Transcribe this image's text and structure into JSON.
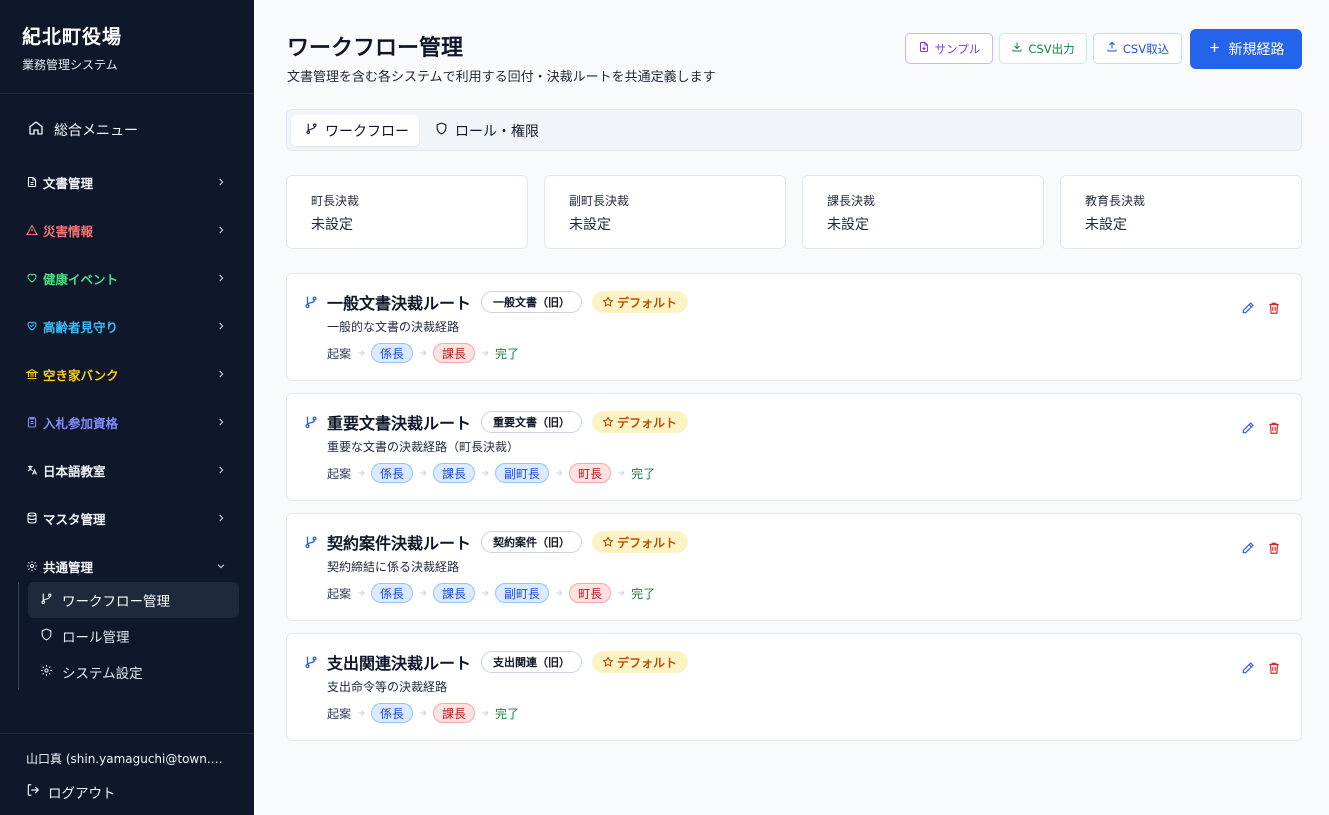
{
  "sidebar": {
    "brand_title": "紀北町役場",
    "brand_subtitle": "業務管理システム",
    "top_item": "総合メニュー",
    "groups": [
      {
        "label": "文書管理",
        "color": "#f1f5f9",
        "icon": "document-icon"
      },
      {
        "label": "災害情報",
        "color": "#f87171",
        "icon": "warning-icon"
      },
      {
        "label": "健康イベント",
        "color": "#4ade80",
        "icon": "heart-icon"
      },
      {
        "label": "高齢者見守り",
        "color": "#38bdf8",
        "icon": "heart-handshake-icon"
      },
      {
        "label": "空き家バンク",
        "color": "#facc15",
        "icon": "landmark-icon"
      },
      {
        "label": "入札参加資格",
        "color": "#818cf8",
        "icon": "clipboard-icon"
      },
      {
        "label": "日本語教室",
        "color": "#f1f5f9",
        "icon": "languages-icon"
      },
      {
        "label": "マスタ管理",
        "color": "#f1f5f9",
        "icon": "database-icon"
      },
      {
        "label": "共通管理",
        "color": "#f1f5f9",
        "icon": "gear-icon"
      }
    ],
    "sub_items": [
      {
        "label": "ワークフロー管理",
        "icon": "workflow-icon"
      },
      {
        "label": "ロール管理",
        "icon": "shield-icon"
      },
      {
        "label": "システム設定",
        "icon": "gear-icon"
      }
    ],
    "user": "山口真 (shin.yamaguchi@town.mi...",
    "logout": "ログアウト"
  },
  "header": {
    "title": "ワークフロー管理",
    "description": "文書管理を含む各システムで利用する回付・決裁ルートを共通定義します",
    "btn_sample": "サンプル",
    "btn_csv_out": "CSV出力",
    "btn_csv_in": "CSV取込",
    "btn_new": "新規経路"
  },
  "tabs": {
    "workflow": "ワークフロー",
    "role": "ロール・権限"
  },
  "summary": [
    {
      "label": "町長決裁",
      "value": "未設定"
    },
    {
      "label": "副町長決裁",
      "value": "未設定"
    },
    {
      "label": "課長決裁",
      "value": "未設定"
    },
    {
      "label": "教育長決裁",
      "value": "未設定"
    }
  ],
  "routes": [
    {
      "name": "一般文書決裁ルート",
      "type": "一般文書（旧）",
      "default": "デフォルト",
      "description": "一般的な文書の決裁経路",
      "start": "起案",
      "end": "完了",
      "steps": [
        {
          "label": "係長",
          "tone": "blue"
        },
        {
          "label": "課長",
          "tone": "red"
        }
      ]
    },
    {
      "name": "重要文書決裁ルート",
      "type": "重要文書（旧）",
      "default": "デフォルト",
      "description": "重要な文書の決裁経路（町長決裁）",
      "start": "起案",
      "end": "完了",
      "steps": [
        {
          "label": "係長",
          "tone": "blue"
        },
        {
          "label": "課長",
          "tone": "blue"
        },
        {
          "label": "副町長",
          "tone": "blue"
        },
        {
          "label": "町長",
          "tone": "red"
        }
      ]
    },
    {
      "name": "契約案件決裁ルート",
      "type": "契約案件（旧）",
      "default": "デフォルト",
      "description": "契約締結に係る決裁経路",
      "start": "起案",
      "end": "完了",
      "steps": [
        {
          "label": "係長",
          "tone": "blue"
        },
        {
          "label": "課長",
          "tone": "blue"
        },
        {
          "label": "副町長",
          "tone": "blue"
        },
        {
          "label": "町長",
          "tone": "red"
        }
      ]
    },
    {
      "name": "支出関連決裁ルート",
      "type": "支出関連（旧）",
      "default": "デフォルト",
      "description": "支出命令等の決裁経路",
      "start": "起案",
      "end": "完了",
      "steps": [
        {
          "label": "係長",
          "tone": "blue"
        },
        {
          "label": "課長",
          "tone": "red"
        }
      ]
    }
  ]
}
